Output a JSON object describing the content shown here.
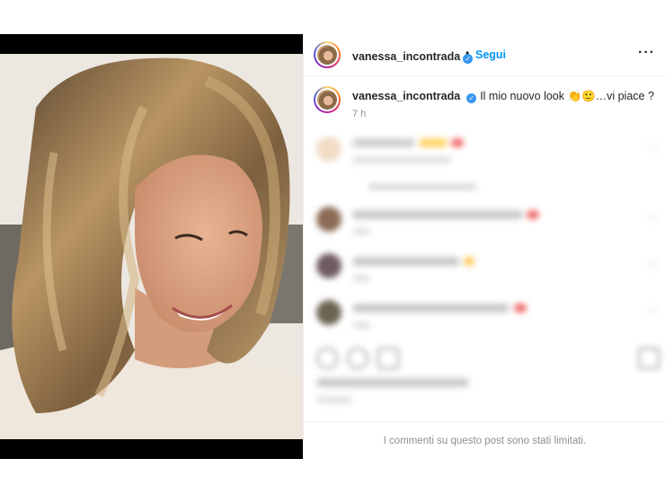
{
  "post": {
    "username": "vanessa_incontrada",
    "follow_label": "Segui",
    "separator": "•",
    "more_icon": "more-options-icon",
    "verified_icon": "verified-badge-icon"
  },
  "caption": {
    "username": "vanessa_incontrada",
    "text": "Il mio nuovo look 👏🙂…vi piace ?",
    "time": "7 h"
  },
  "footer": {
    "comments_limited": "I commenti su questo post sono stati limitati."
  },
  "colors": {
    "link_blue": "#0095f6",
    "verified_blue": "#3897f0",
    "muted_text": "#8e8e8e"
  }
}
